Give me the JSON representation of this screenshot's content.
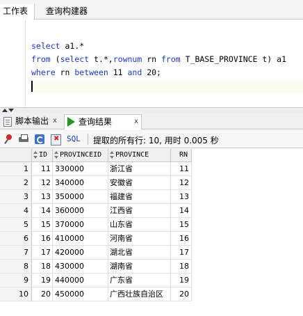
{
  "top_tabs": [
    {
      "label": "工作表"
    },
    {
      "label": "查询构建器"
    }
  ],
  "editor": {
    "line1": {
      "kw": "select",
      "rest": " a1.*"
    },
    "line2": {
      "kw1": "from",
      "p1": " (",
      "kw2": "select",
      "p2": " t.*,",
      "kw3": "rownum",
      "p3": " rn ",
      "kw4": "from",
      "p4": " T_BASE_PROVINCE t) a1"
    },
    "line3": {
      "kw1": "where",
      "p1": " rn ",
      "kw2": "between",
      "p2": " 11 ",
      "kw3": "and",
      "p3": " 20;"
    }
  },
  "bottom_tabs": [
    {
      "label": "脚本输出",
      "close": "x",
      "icon": "script-output-icon"
    },
    {
      "label": "查询结果",
      "close": "x",
      "icon": "run-icon",
      "active": true
    }
  ],
  "toolbar": {
    "icons": [
      "pin-icon",
      "print-icon",
      "refresh-icon",
      "cancel-icon"
    ],
    "sql_label": "SQL",
    "status_text": "提取的所有行: 10, 用时 0.005 秒"
  },
  "grid": {
    "columns": [
      "ID",
      "PROVINCEID",
      "PROVINCE",
      "RN"
    ],
    "rows": [
      {
        "num": "1",
        "id": "11",
        "pid": "330000",
        "prov": "浙江省",
        "rn": "11"
      },
      {
        "num": "2",
        "id": "12",
        "pid": "340000",
        "prov": "安徽省",
        "rn": "12"
      },
      {
        "num": "3",
        "id": "13",
        "pid": "350000",
        "prov": "福建省",
        "rn": "13"
      },
      {
        "num": "4",
        "id": "14",
        "pid": "360000",
        "prov": "江西省",
        "rn": "14"
      },
      {
        "num": "5",
        "id": "15",
        "pid": "370000",
        "prov": "山东省",
        "rn": "15"
      },
      {
        "num": "6",
        "id": "16",
        "pid": "410000",
        "prov": "河南省",
        "rn": "16"
      },
      {
        "num": "7",
        "id": "17",
        "pid": "420000",
        "prov": "湖北省",
        "rn": "17"
      },
      {
        "num": "8",
        "id": "18",
        "pid": "430000",
        "prov": "湖南省",
        "rn": "18"
      },
      {
        "num": "9",
        "id": "19",
        "pid": "440000",
        "prov": "广东省",
        "rn": "19"
      },
      {
        "num": "10",
        "id": "20",
        "pid": "450000",
        "prov": "广西壮族自治区",
        "rn": "20"
      }
    ]
  }
}
